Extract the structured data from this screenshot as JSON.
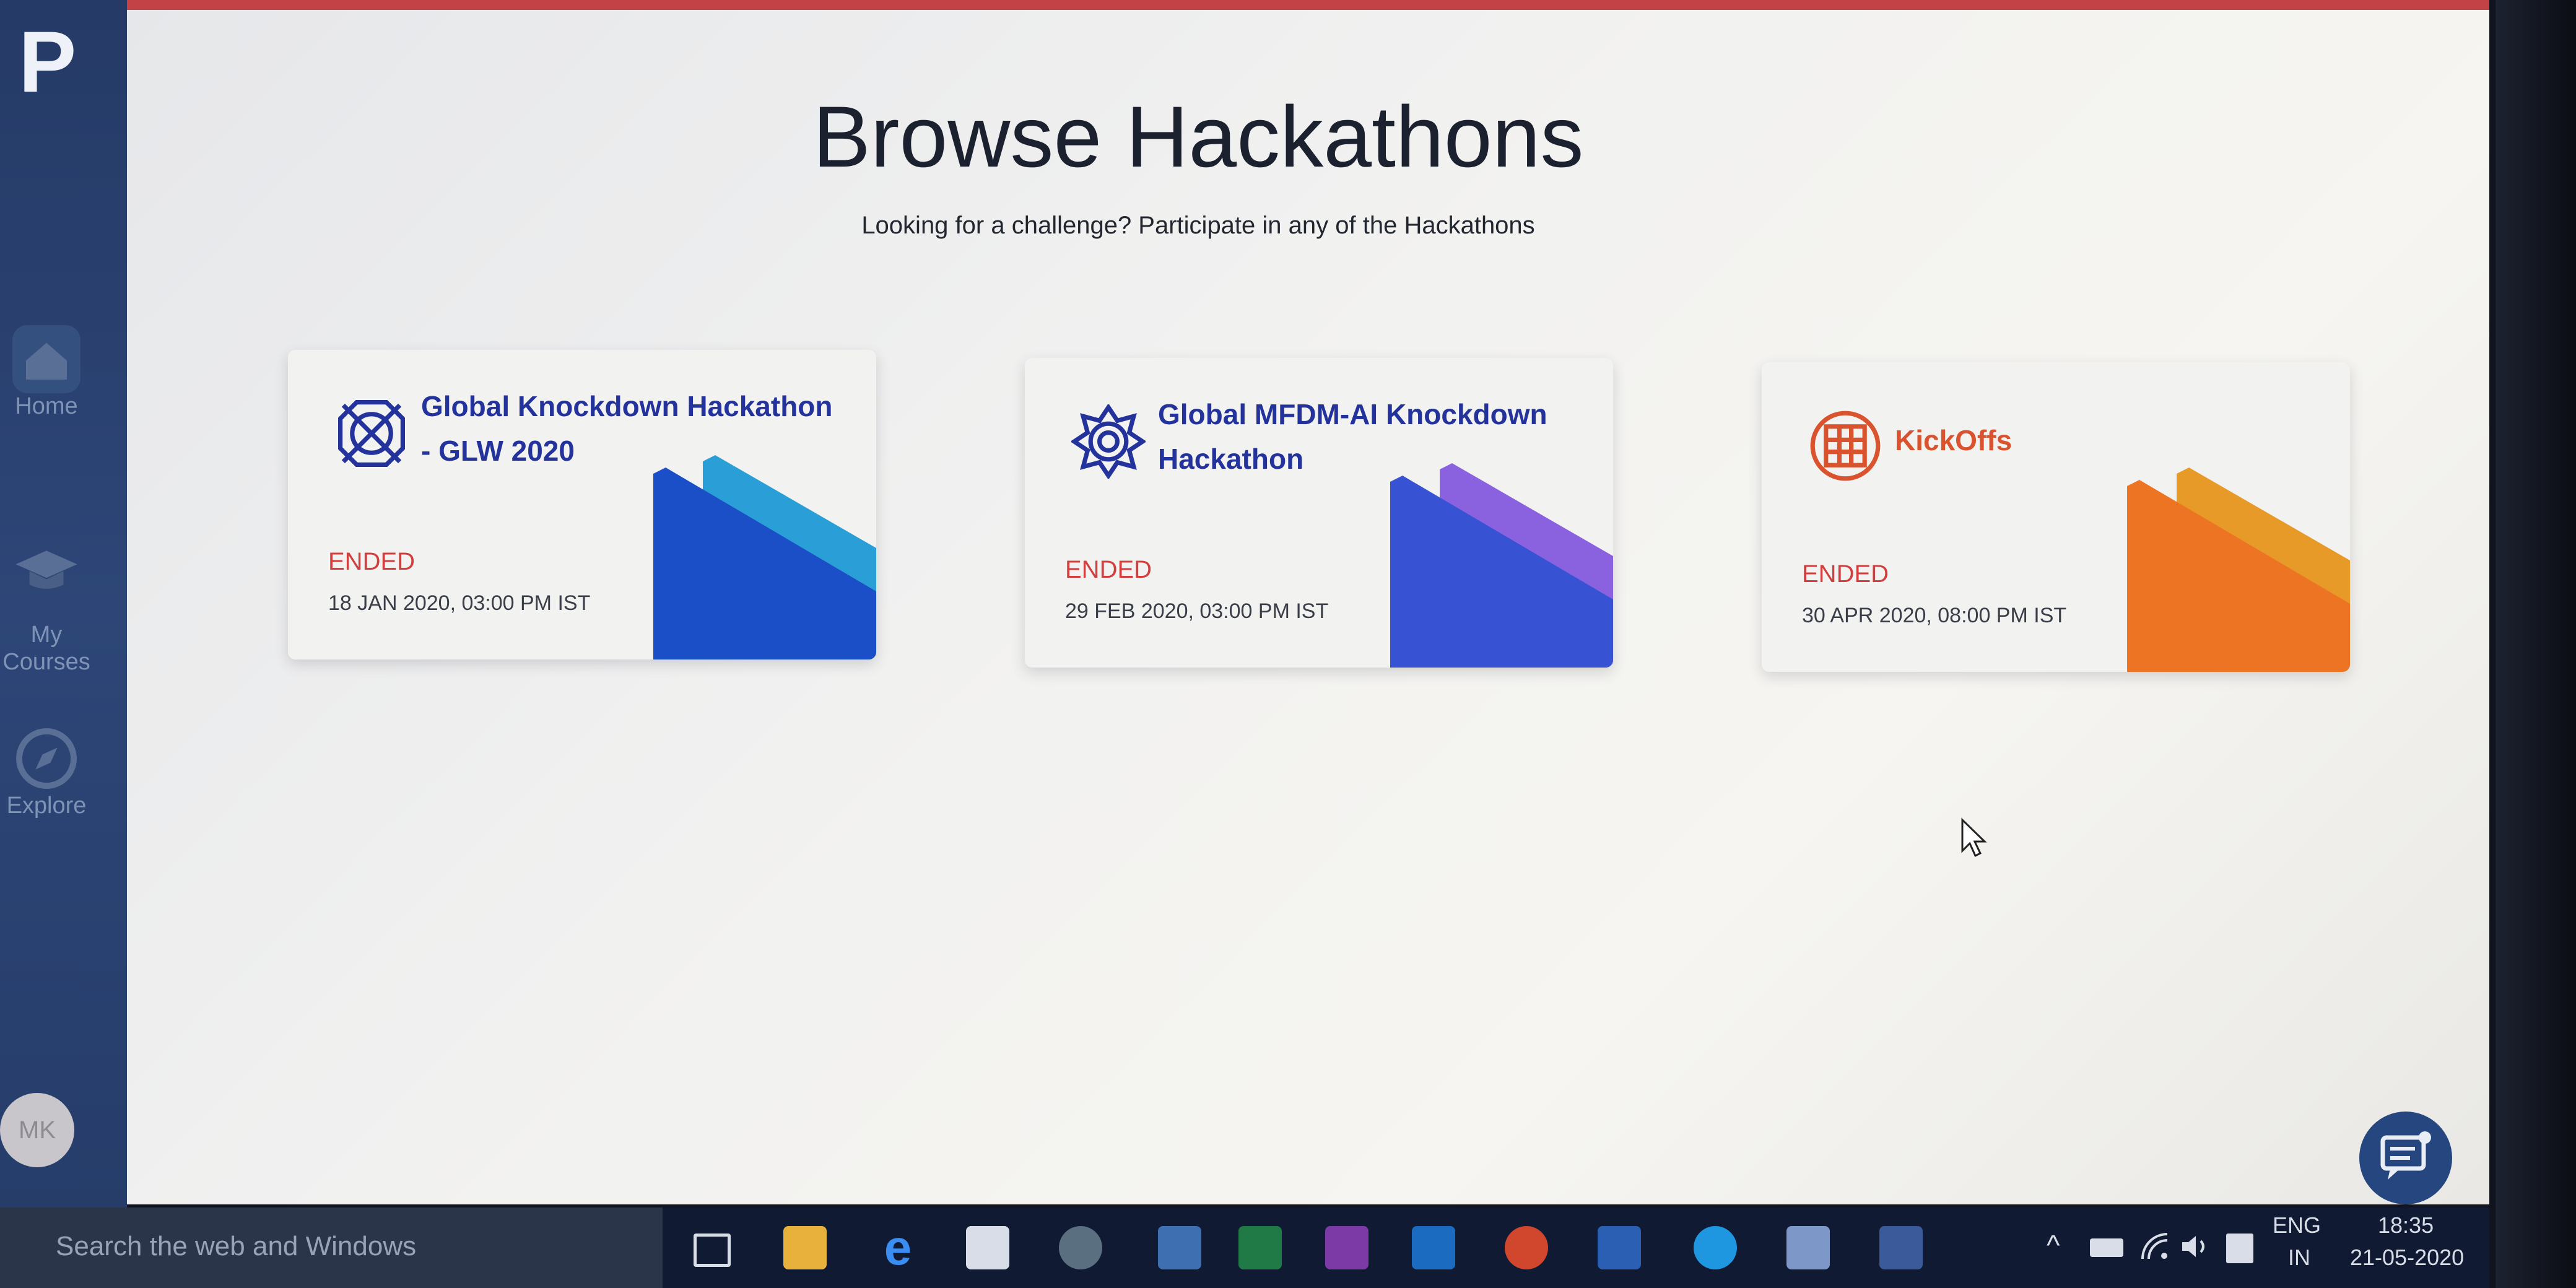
{
  "sidebar": {
    "brand": "P",
    "items": [
      {
        "label": "Home",
        "icon": "home-icon"
      },
      {
        "label": "My\nCourses",
        "icon": "graduation-cap-icon"
      },
      {
        "label": "Explore",
        "icon": "compass-icon"
      }
    ],
    "avatar": "MK"
  },
  "page": {
    "title": "Browse Hackathons",
    "subtitle": "Looking for a challenge? Participate in any of the Hackathons"
  },
  "cards": [
    {
      "title": "Global Knockdown Hackathon - GLW 2020",
      "status": "ENDED",
      "date": "18 JAN 2020, 03:00 PM IST",
      "title_color": "#24339b",
      "status_color": "#d23d3d",
      "deco_color_a": "#2a9ed6",
      "deco_color_b": "#1b4fc7"
    },
    {
      "title": "Global MFDM-AI Knockdown Hackathon",
      "status": "ENDED",
      "date": "29 FEB 2020, 03:00 PM IST",
      "title_color": "#24339b",
      "status_color": "#d23d3d",
      "deco_color_a": "#8a62e0",
      "deco_color_b": "#3852d4"
    },
    {
      "title": "KickOffs",
      "status": "ENDED",
      "date": "30 APR 2020, 08:00 PM IST",
      "title_color": "#d9532e",
      "status_color": "#d23d3d",
      "deco_color_a": "#e79a28",
      "deco_color_b": "#ec7422"
    }
  ],
  "taskbar": {
    "search_placeholder": "Search the web and Windows",
    "language": "ENG",
    "region": "IN",
    "time": "18:35",
    "date": "21-05-2020",
    "apps": [
      "task-view-icon",
      "file-explorer-icon",
      "edge-icon",
      "store-icon",
      "chrome-icon",
      "python-icon",
      "excel-icon",
      "onenote-icon",
      "outlook-icon",
      "powerpoint-icon",
      "word-icon",
      "skype-icon",
      "app-icon",
      "tata-icon"
    ]
  },
  "colors": {
    "accent_red": "#c34245",
    "sidebar_blue": "#2a426f",
    "chat_button": "#26467f"
  }
}
